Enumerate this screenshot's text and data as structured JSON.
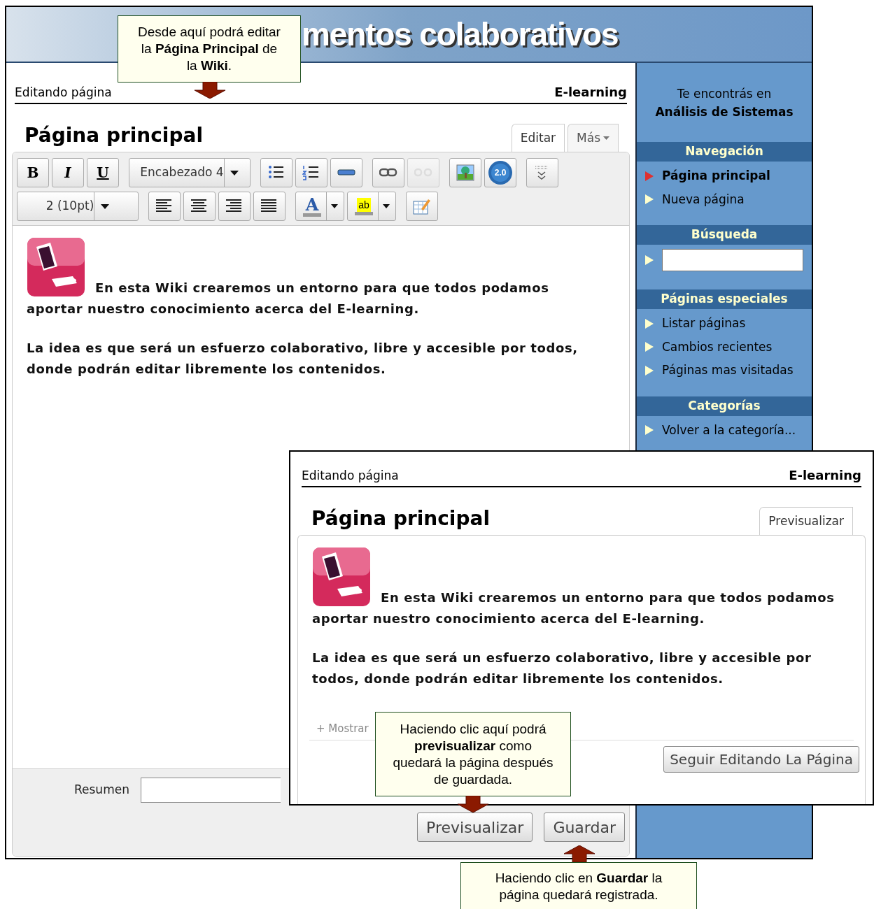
{
  "banner": {
    "title": "mentos colaborativos"
  },
  "editor_window": {
    "breadcrumb": "Editando página",
    "wiki_name": "E-learning",
    "page_title": "Página principal",
    "tabs": [
      {
        "label": "Editar",
        "selected": true,
        "dropdown": false
      },
      {
        "label": "Más",
        "selected": false,
        "dropdown": true
      }
    ],
    "toolbar_rows": [
      [
        {
          "kind": "text",
          "label": "B"
        },
        {
          "kind": "text",
          "label": "I"
        },
        {
          "kind": "text",
          "label": "U"
        },
        {
          "kind": "select",
          "label": "Encabezado 4"
        },
        {
          "kind": "icon",
          "disabled": false
        },
        {
          "kind": "icon",
          "disabled": false
        },
        {
          "kind": "icon",
          "disabled": false
        },
        {
          "kind": "icon",
          "disabled": false
        },
        {
          "kind": "icon",
          "disabled": true
        },
        {
          "kind": "icon",
          "disabled": false
        },
        {
          "kind": "badge",
          "label": "2.0"
        },
        {
          "kind": "icon",
          "disabled": false
        }
      ],
      [
        {
          "kind": "select",
          "label": "2 (10pt)"
        },
        {
          "kind": "icon",
          "disabled": false
        },
        {
          "kind": "icon",
          "disabled": false
        },
        {
          "kind": "icon",
          "disabled": false
        },
        {
          "kind": "icon",
          "disabled": false
        },
        {
          "kind": "split",
          "label": "A"
        },
        {
          "kind": "split",
          "label": "ab"
        },
        {
          "kind": "icon",
          "disabled": false
        }
      ]
    ],
    "paragraphs": [
      "En esta Wiki crearemos un entorno para que todos podamos aportar nuestro conocimiento acerca del E-learning.",
      "La idea es que será un esfuerzo colaborativo, libre y accesible por todos, donde podrán editar libremente los contenidos."
    ],
    "summary": {
      "label": "Resumen"
    },
    "buttons": [
      "Previsualizar",
      "Guardar"
    ]
  },
  "sidebar": {
    "location_intro": "Te encontrás en",
    "location": "Análisis de Sistemas",
    "sections": [
      {
        "title": "Navegación",
        "kind": "links",
        "items": [
          {
            "label": "Página principal",
            "selected": true
          },
          {
            "label": "Nueva página",
            "selected": false
          }
        ]
      },
      {
        "title": "Búsqueda",
        "kind": "search"
      },
      {
        "title": "Páginas especiales",
        "kind": "links",
        "items": [
          {
            "label": "Listar páginas",
            "selected": false
          },
          {
            "label": "Cambios recientes",
            "selected": false
          },
          {
            "label": "Páginas mas visitadas",
            "selected": false
          }
        ]
      },
      {
        "title": "Categorías",
        "kind": "links",
        "items": [
          {
            "label": "Volver a la categoría...",
            "selected": false
          }
        ]
      }
    ]
  },
  "preview_window": {
    "breadcrumb": "Editando página",
    "wiki_name": "E-learning",
    "page_title": "Página principal",
    "tabs": [
      {
        "label": "Previsualizar",
        "selected": true
      }
    ],
    "paragraphs": [
      "En esta Wiki crearemos un entorno para que todos podamos aportar nuestro conocimiento acerca del E-learning.",
      "La idea es que será un esfuerzo colaborativo, libre y accesible por todos, donde podrán editar libremente los contenidos."
    ],
    "toggle": "+ Mostrar",
    "button": "Seguir Editando La Página"
  },
  "callouts": [
    {
      "text": "Desde aquí podrá editar la **Página Principal** de la **Wiki**."
    },
    {
      "text": "Haciendo clic aquí podrá **previsualizar** como quedará la página después de guardada."
    },
    {
      "text": "Haciendo clic en **Guardar** la página quedará registrada."
    }
  ]
}
